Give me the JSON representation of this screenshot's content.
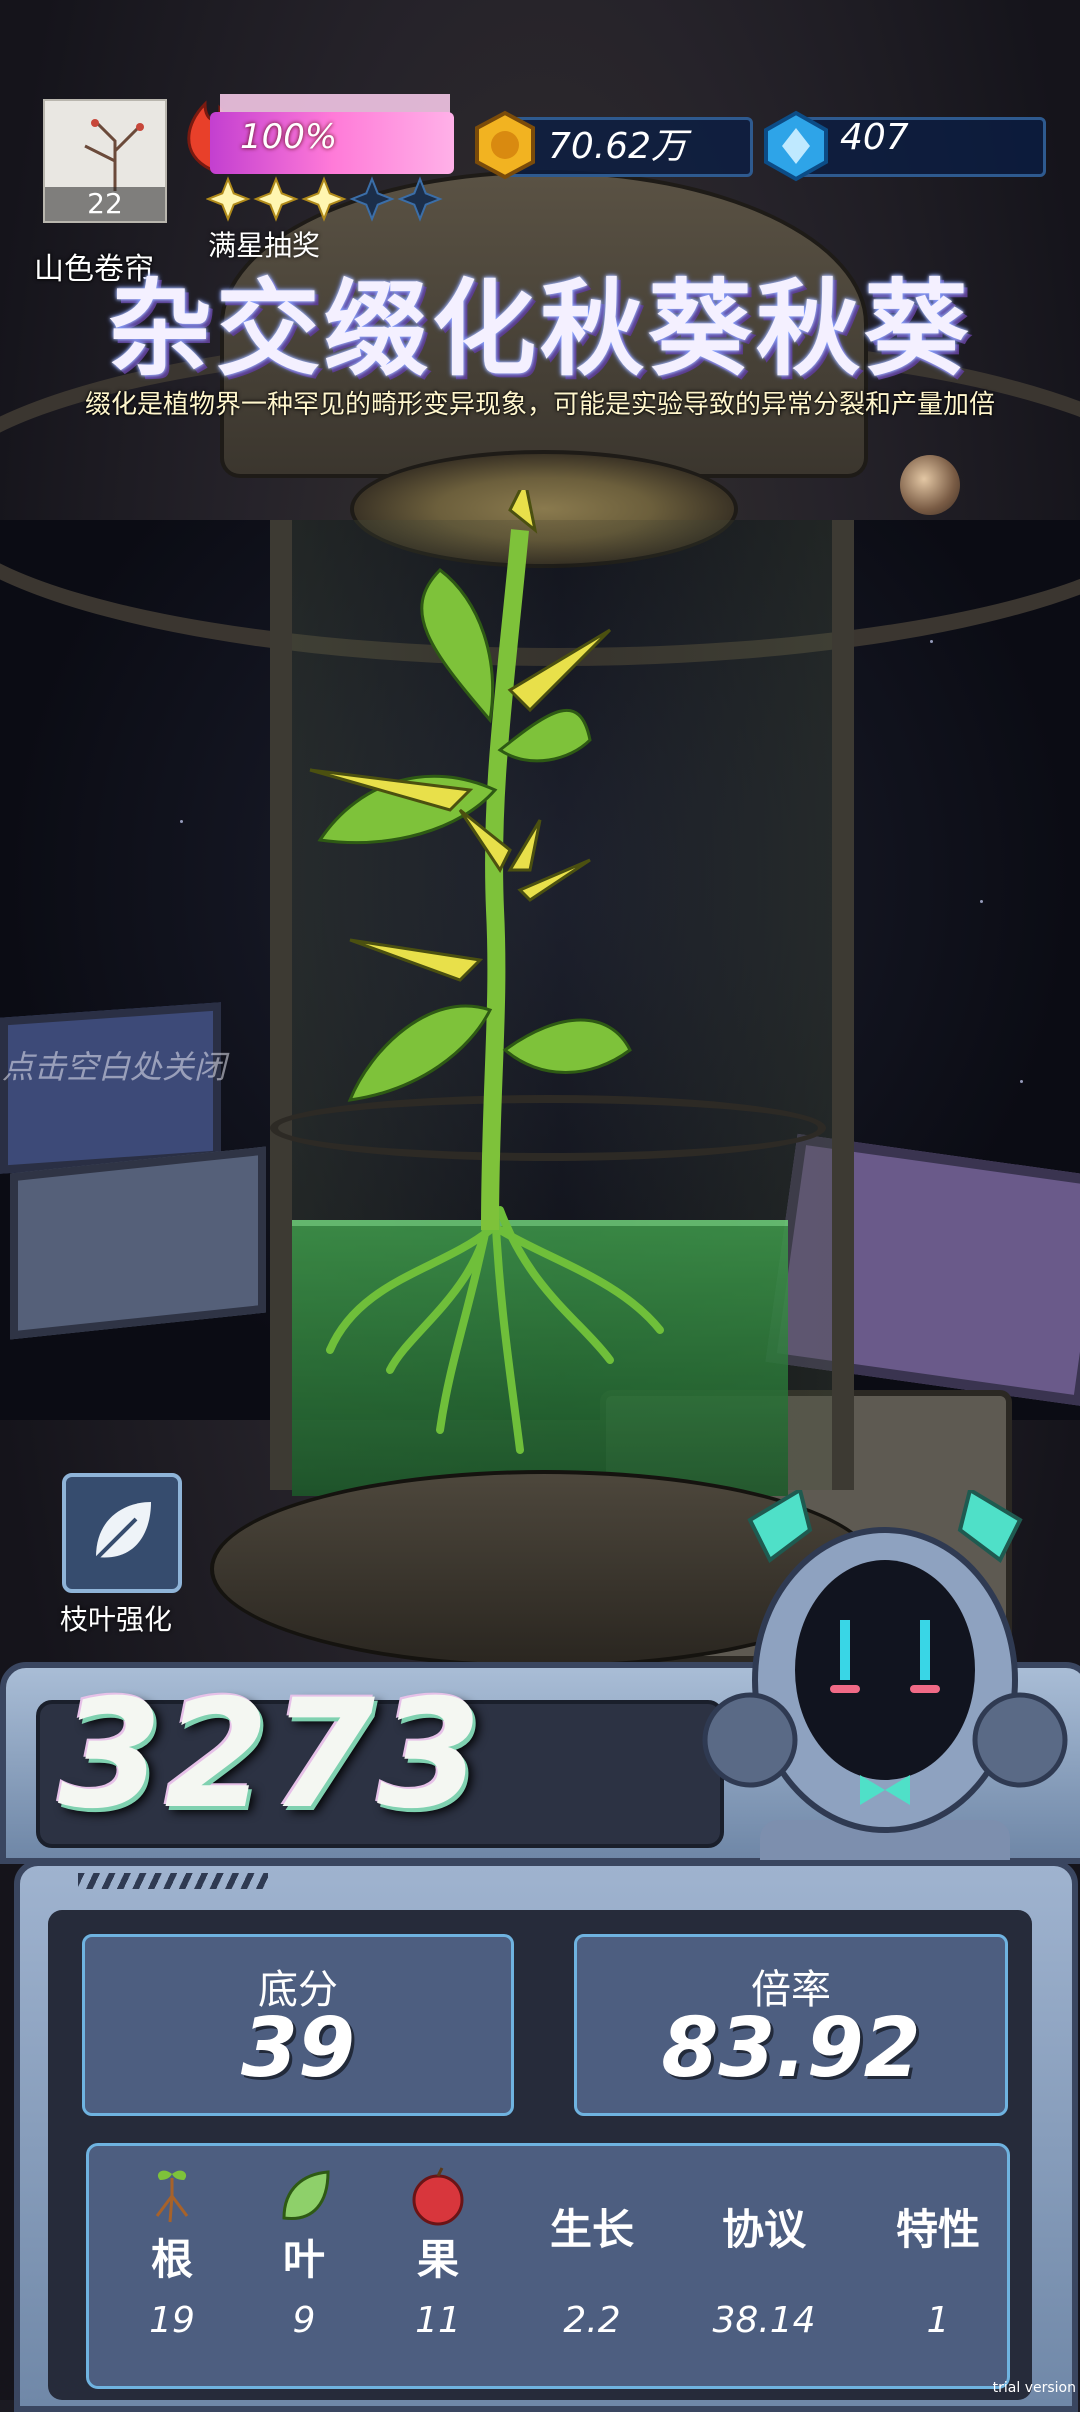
{
  "player": {
    "name": "山色卷帘",
    "level": "22"
  },
  "energy": {
    "percent_text": "100%",
    "progress": 1.0,
    "stars_filled": 3,
    "stars_total": 5,
    "lottery_label": "满星抽奖"
  },
  "currency": {
    "coins": "70.62万",
    "gems": "407"
  },
  "plant": {
    "title": "杂交缀化秋葵秋葵",
    "description": "缀化是植物界一种罕见的畸形变异现象，可能是实验导致的异常分裂和产量加倍"
  },
  "hints": {
    "close": "点击空白处关闭"
  },
  "actions": {
    "leaf_upgrade_label": "枝叶强化"
  },
  "score": {
    "total": "3273",
    "base_label": "底分",
    "base_value": "39",
    "multiplier_label": "倍率",
    "multiplier_value": "83.92"
  },
  "stats": [
    {
      "label": "根",
      "value": "19",
      "icon": "root-icon"
    },
    {
      "label": "叶",
      "value": "9",
      "icon": "leaf-icon"
    },
    {
      "label": "果",
      "value": "11",
      "icon": "fruit-icon"
    },
    {
      "label": "生长",
      "value": "2.2",
      "icon": ""
    },
    {
      "label": "协议",
      "value": "38.14",
      "icon": ""
    },
    {
      "label": "特性",
      "value": "1",
      "icon": ""
    }
  ],
  "watermark": "trial version",
  "colors": {
    "progress_start": "#c33fd0",
    "progress_end": "#ffb1e8",
    "panel_accent": "#6fb3e0",
    "plant_green": "#7ec23a",
    "flower_yellow": "#e8e04a"
  }
}
